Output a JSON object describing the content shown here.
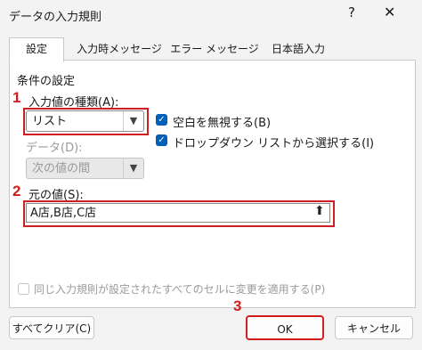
{
  "window": {
    "title": "データの入力規則",
    "help": "?",
    "close": "✕"
  },
  "tabs": [
    "設定",
    "入力時メッセージ",
    "エラー メッセージ",
    "日本語入力"
  ],
  "settings": {
    "group_title": "条件の設定",
    "allow_label": "入力値の種類(A):",
    "allow_value": "リスト",
    "data_label": "データ(D):",
    "data_value": "次の値の間",
    "ignore_blank": "空白を無視する(B)",
    "dropdown": "ドロップダウン リストから選択する(I)",
    "source_label": "元の値(S):",
    "source_value": "A店,B店,C店",
    "apply_all": "同じ入力規則が設定されたすべてのセルに変更を適用する(P)"
  },
  "callouts": {
    "n1": "1",
    "n2": "2",
    "n3": "3"
  },
  "buttons": {
    "clear": "すべてクリア(C)",
    "ok": "OK",
    "cancel": "キャンセル"
  },
  "colors": {
    "accent": "#005fb8",
    "callout": "#d01e1e"
  }
}
